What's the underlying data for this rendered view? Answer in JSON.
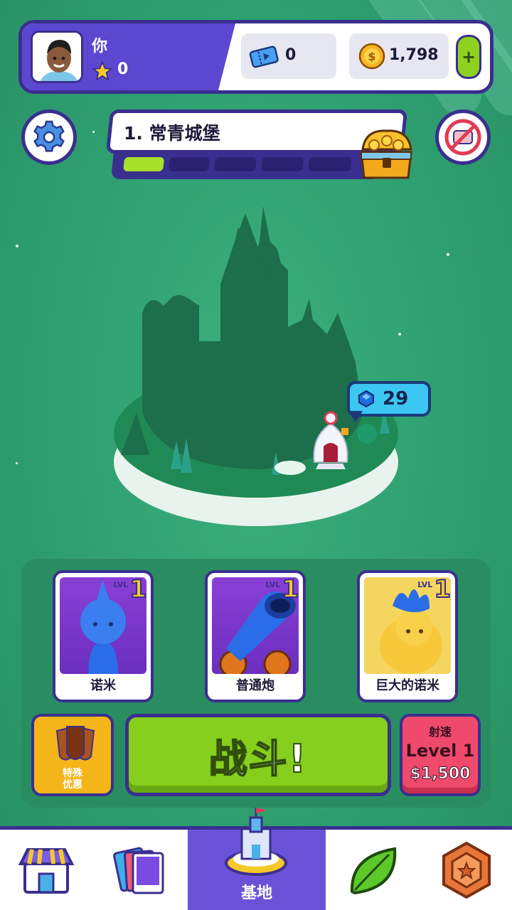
{
  "player": {
    "name": "你",
    "stars": "0"
  },
  "resources": {
    "tickets": "0",
    "coins": "1,798",
    "add_label": "+"
  },
  "level": {
    "title": "1. 常青城堡",
    "progress_segments_total": 6,
    "progress_segments_filled": 1
  },
  "island": {
    "gem_count": "29"
  },
  "cards": [
    {
      "name": "诺米",
      "lvl_text": "LVL",
      "lvl_num": "1"
    },
    {
      "name": "普通炮",
      "lvl_text": "LVL",
      "lvl_num": "1"
    },
    {
      "name": "巨大的诺米",
      "lvl_text": "LVL",
      "lvl_num": "1"
    }
  ],
  "actions": {
    "offer_label_line1": "特殊",
    "offer_label_line2": "优惠",
    "fight_label": "战斗!",
    "rate_title": "射速",
    "rate_level": "Level 1",
    "rate_price": "$1,500"
  },
  "nav": {
    "active_label": "基地",
    "items": [
      "shop-icon",
      "cards-icon",
      "base-icon",
      "leaf-icon",
      "badge-icon"
    ]
  },
  "colors": {
    "background": "#2f9f70",
    "outline": "#3a2f8f",
    "accent_purple": "#5c47d1",
    "fight_green": "#86cf1c",
    "offer_gold": "#f4b519",
    "rate_pink": "#ef4a6c"
  }
}
